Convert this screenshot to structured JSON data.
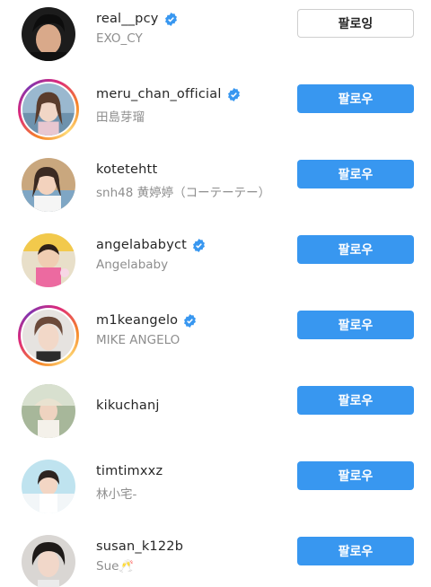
{
  "users": [
    {
      "username": "real__pcy",
      "full_name": "EXO_CY",
      "verified": true,
      "story": false,
      "button": "팔로잉",
      "button_state": "following"
    },
    {
      "username": "meru_chan_official",
      "full_name": "田島芽瑠",
      "verified": true,
      "story": true,
      "button": "팔로우",
      "button_state": "follow"
    },
    {
      "username": "kotetehtt",
      "full_name": "snh48 黄婷婷（コーテーテー）",
      "verified": false,
      "story": false,
      "button": "팔로우",
      "button_state": "follow"
    },
    {
      "username": "angelababyct",
      "full_name": "Angelababy",
      "verified": true,
      "story": false,
      "button": "팔로우",
      "button_state": "follow"
    },
    {
      "username": "m1keangelo",
      "full_name": "MIKE ANGELO",
      "verified": true,
      "story": true,
      "button": "팔로우",
      "button_state": "follow"
    },
    {
      "username": "kikuchanj",
      "full_name": "",
      "verified": false,
      "story": false,
      "button": "팔로우",
      "button_state": "follow"
    },
    {
      "username": "timtimxxz",
      "full_name": "林小宅-",
      "verified": false,
      "story": false,
      "button": "팔로우",
      "button_state": "follow"
    },
    {
      "username": "susan_k122b",
      "full_name": "Sue🥂",
      "verified": false,
      "story": false,
      "button": "팔로우",
      "button_state": "follow"
    }
  ],
  "colors": {
    "follow_blue": "#3897f0",
    "verified_blue": "#3897f0",
    "username_text": "#262626",
    "fullname_text": "#8e8e8e"
  }
}
